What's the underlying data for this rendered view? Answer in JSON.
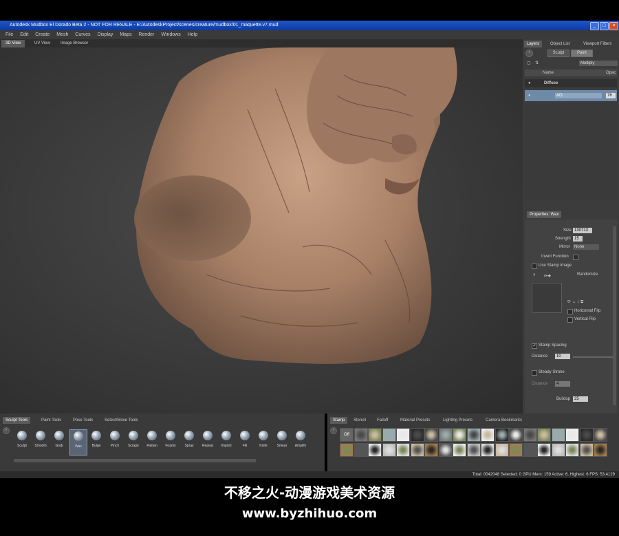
{
  "window": {
    "title": "Autodesk Mudbox El Dorado Beta 2 - NOT FOR RESALE - E:/AutodeskProject/scenes/creature/mudbox/01_maquette.v7.mud"
  },
  "menu": [
    "File",
    "Edit",
    "Create",
    "Mesh",
    "Curves",
    "Display",
    "Maps",
    "Render",
    "Windows",
    "Help"
  ],
  "view_tabs": [
    "3D View",
    "UV View",
    "Image Browser"
  ],
  "right_tabs": [
    "Layers",
    "Object List",
    "Viewport Filters"
  ],
  "layers": {
    "mode_tabs": [
      "Sculpt",
      "Paint"
    ],
    "blend_mode": "Multiply",
    "col_name": "Name",
    "col_opacity": "Opac",
    "group": "Diffuse",
    "layer_name": "AO",
    "layer_opacity": "76"
  },
  "properties": {
    "tab": "Properties: Wax",
    "size_label": "Size",
    "size_value": "130713",
    "strength_label": "Strength",
    "strength_value": "15",
    "mirror_label": "Mirror",
    "mirror_value": "None",
    "invert_label": "Invert Function",
    "use_stamp_label": "Use Stamp Image",
    "randomize_label": "Randomize",
    "hflip_label": "Horizontal Flip",
    "vflip_label": "Vertical Flip",
    "stamp_spacing_label": "Stamp Spacing",
    "distance_label": "Distance",
    "distance_value": "10",
    "steady_stroke_label": "Steady Stroke",
    "distance2_label": "Distance",
    "distance2_value": "4",
    "buildup_label": "Buildup",
    "buildup_value": "25"
  },
  "bottom_tool_tabs": [
    "Sculpt Tools",
    "Paint Tools",
    "Pose Tools",
    "Select/Move Tools"
  ],
  "tools": [
    "Sculpt",
    "Smooth",
    "Grab",
    "Wax",
    "Bulge",
    "Pinch",
    "Scrape",
    "Flatten",
    "Foamy",
    "Spray",
    "Repeat",
    "Imprint",
    "Fill",
    "Knife",
    "Smear",
    "Amplify"
  ],
  "active_tool": "Wax",
  "stamp_tabs": [
    "Stamp",
    "Stencil",
    "Falloff",
    "Material Presets",
    "Lighting Presets",
    "Camera Bookmarks"
  ],
  "stamp_off_label": "Off",
  "status": "Total: 0042048  Selected: 0  GPU Mem: 159  Active: 6, Highest: 6  FPS: 53.4129",
  "watermark": {
    "line1": "不移之火-动漫游戏美术资源",
    "line2": "www.byzhihuo.com"
  },
  "colors": {
    "accent": "#1f56c9",
    "skin": "#b08a70"
  },
  "icons": {
    "window_controls": [
      "minimize-icon",
      "maximize-icon",
      "close-icon"
    ]
  }
}
